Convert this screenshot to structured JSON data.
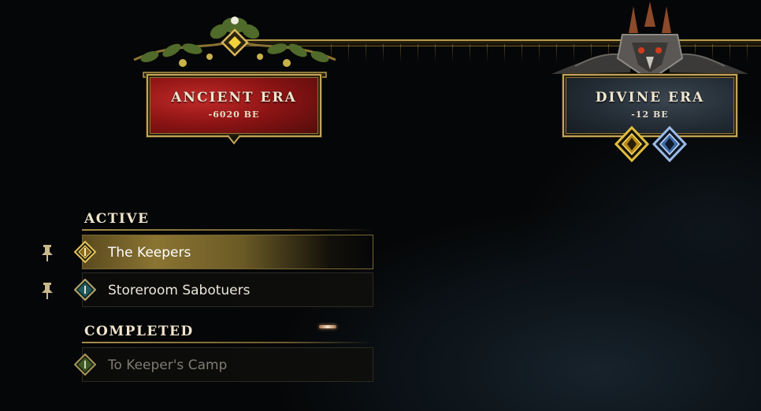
{
  "eras": {
    "ancient": {
      "name": "ANCIENT ERA",
      "year": "-6020 BE",
      "color": "#8e1414"
    },
    "divine": {
      "name": "DIVINE ERA",
      "year": "-12 BE",
      "color": "#222b33"
    }
  },
  "divine_badges": [
    {
      "icon": "gold-diamond-badge-icon",
      "color": "#d8b23a"
    },
    {
      "icon": "blue-diamond-badge-icon",
      "color": "#8fb2e0"
    }
  ],
  "quests": {
    "active_heading": "ACTIVE",
    "completed_heading": "COMPLETED",
    "active": [
      {
        "label": "The Keepers",
        "selected": true,
        "icon": "gold-quest-marker-icon",
        "pinned": true
      },
      {
        "label": "Storeroom Sabotuers",
        "selected": false,
        "icon": "teal-quest-marker-icon",
        "pinned": true
      }
    ],
    "completed": [
      {
        "label": "To Keeper's Camp",
        "icon": "green-quest-marker-icon"
      }
    ]
  }
}
